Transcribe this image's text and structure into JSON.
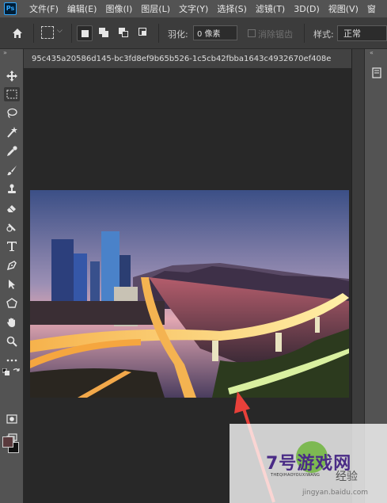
{
  "app": {
    "logo_text": "Ps"
  },
  "menu": {
    "items": [
      "文件(F)",
      "编辑(E)",
      "图像(I)",
      "图层(L)",
      "文字(Y)",
      "选择(S)",
      "滤镜(T)",
      "3D(D)",
      "视图(V)",
      "窗"
    ]
  },
  "options": {
    "feather_label": "羽化:",
    "feather_value": "0 像素",
    "antialias_label": "消除锯齿",
    "style_label": "样式:",
    "style_value": "正常"
  },
  "document": {
    "tab_title": "95c435a20586d145-bc3fd8ef9b65b526-1c5cb42fbba1643c4932670ef408e"
  },
  "toolbar": {
    "collapse_glyph": "»",
    "tools": [
      "move-tool",
      "rect-marquee-tool",
      "lasso-tool",
      "quick-select-tool",
      "eyedropper-tool",
      "brush-tool",
      "clone-stamp-tool",
      "eraser-tool",
      "pen-tool",
      "type-tool",
      "path-select-tool",
      "shape-tool",
      "hand-tool",
      "zoom-tool",
      "more-tools",
      "swap-colors",
      "quick-mask",
      "screen-mode"
    ],
    "foreground_color": "#5a3a3d",
    "background_color": "#111111"
  },
  "right_panel": {
    "collapse_glyph": "«"
  },
  "watermark": {
    "brand": "7号游戏网",
    "sub": "THEQIHAOYOUXIWANG",
    "jingyan": "经验",
    "url": "jingyan.baidu.com"
  },
  "colors": {
    "menu_bg": "#535353",
    "options_bg": "#3c3c3c",
    "canvas_bg": "#282828",
    "arrow": "#e8403a",
    "ps_blue": "#31a8ff"
  }
}
